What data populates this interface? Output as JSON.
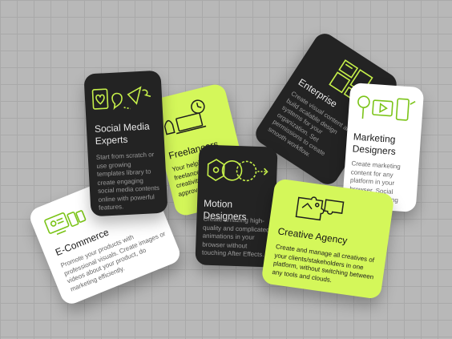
{
  "cards": {
    "ecommerce": {
      "title": "E-Commerce",
      "desc": "Promote your products with professional visuals. Create images or videos about your product, do marketing efficiently."
    },
    "enterprise": {
      "title": "Enterprise",
      "desc": "Create visual content and build scalable design systems for your organization. Set permissions to create smooth workflow."
    },
    "marketing": {
      "title": "Marketing Designers",
      "desc": "Create marketing content for any platform in your browser. Social media, marketing"
    },
    "freelancers": {
      "title": "Freelancers",
      "desc": "Your helping freelancers Unleash creativity done approval every"
    },
    "social": {
      "title": "Social Media Experts",
      "desc": "Start from scratch or use growing templates library to create engaging social media contents online with powerful features."
    },
    "motion": {
      "title": "Motion Designers",
      "desc": "Create amazing high-quality and complicated animations in your browser without touching After Effects."
    },
    "agency": {
      "title": "Creative Agency",
      "desc": "Create and manage all creatives of your clients/stakeholders in one platform, without switching between any tools and clouds."
    }
  },
  "icons": {
    "ecommerce": "shop-devices-icon",
    "enterprise": "layout-grid-icon",
    "marketing": "media-devices-icon",
    "freelancers": "laptop-clock-icon",
    "social": "social-hearts-icon",
    "motion": "motion-hexagon-icon",
    "agency": "puzzle-icon"
  },
  "colors": {
    "background": "#b8b8b8",
    "dark_card": "#232323",
    "lime_card": "#d4f75a",
    "white_card": "#ffffff",
    "accent": "#c6f04a"
  }
}
